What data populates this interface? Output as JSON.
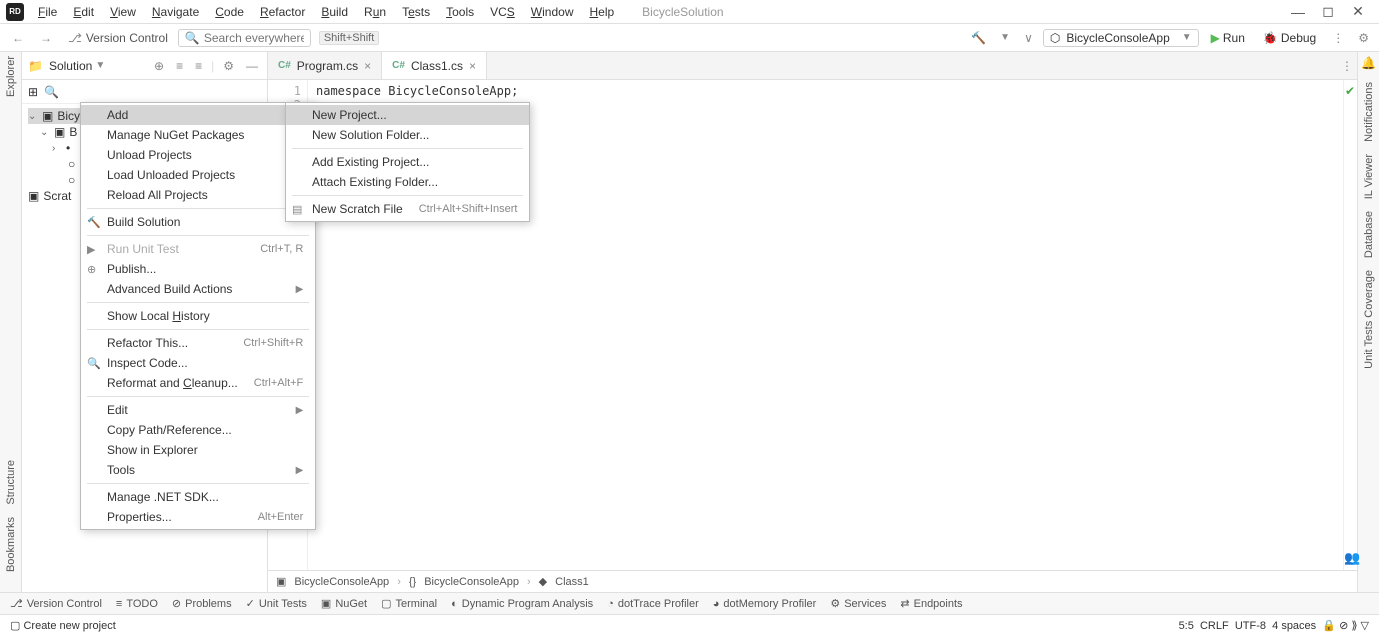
{
  "menubar": {
    "items": [
      "File",
      "Edit",
      "View",
      "Navigate",
      "Code",
      "Refactor",
      "Build",
      "Run",
      "Tests",
      "Tools",
      "VCS",
      "Window",
      "Help"
    ],
    "project": "BicycleSolution"
  },
  "toolbar": {
    "version_control": "Version Control",
    "search_placeholder": "Search everywhere",
    "search_shortcut": "Shift+Shift",
    "run_config": "BicycleConsoleApp",
    "run_label": "Run",
    "debug_label": "Debug"
  },
  "project_panel": {
    "title": "Solution",
    "tree": {
      "root": "Bicyc",
      "row2": "B",
      "scratch": "Scrat"
    }
  },
  "tabs": [
    {
      "label": "Program.cs",
      "lang": "C#"
    },
    {
      "label": "Class1.cs",
      "lang": "C#"
    }
  ],
  "active_tab": 1,
  "code": {
    "lines": [
      "1",
      "2"
    ],
    "content": "namespace BicycleConsoleApp;"
  },
  "breadcrumb": [
    "BicycleConsoleApp",
    "BicycleConsoleApp",
    "Class1"
  ],
  "bottom_tabs": [
    "Version Control",
    "TODO",
    "Problems",
    "Unit Tests",
    "NuGet",
    "Terminal",
    "Dynamic Program Analysis",
    "dotTrace Profiler",
    "dotMemory Profiler",
    "Services",
    "Endpoints"
  ],
  "status": {
    "left": "Create new project",
    "pos": "5:5",
    "le": "CRLF",
    "enc": "UTF-8",
    "indent": "4 spaces"
  },
  "right_rail": [
    "Notifications",
    "IL Viewer",
    "Database",
    "Unit Tests  Coverage"
  ],
  "left_rail": [
    "Explorer",
    "Structure",
    "Bookmarks"
  ],
  "ctx1": {
    "add": "Add",
    "manage_nuget": "Manage NuGet Packages",
    "unload": "Unload Projects",
    "load_unloaded": "Load Unloaded Projects",
    "reload_all": "Reload All Projects",
    "build": "Build Solution",
    "run_unit": "Run Unit Test",
    "run_unit_sc": "Ctrl+T, R",
    "publish": "Publish...",
    "adv_build": "Advanced Build Actions",
    "local_hist": "Show Local History",
    "refactor": "Refactor This...",
    "refactor_sc": "Ctrl+Shift+R",
    "inspect": "Inspect Code...",
    "reformat": "Reformat and Cleanup...",
    "reformat_sc": "Ctrl+Alt+F",
    "edit": "Edit",
    "copy_path": "Copy Path/Reference...",
    "show_explorer": "Show in Explorer",
    "tools": "Tools",
    "manage_sdk": "Manage .NET SDK...",
    "properties": "Properties...",
    "properties_sc": "Alt+Enter"
  },
  "ctx2": {
    "new_project": "New Project...",
    "new_folder": "New Solution Folder...",
    "add_existing": "Add Existing Project...",
    "attach_folder": "Attach Existing Folder...",
    "new_scratch": "New Scratch File",
    "new_scratch_sc": "Ctrl+Alt+Shift+Insert"
  }
}
